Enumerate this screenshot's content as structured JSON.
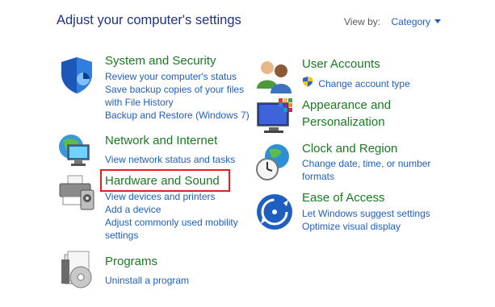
{
  "header": {
    "title": "Adjust your computer's settings",
    "view_by_label": "View by:",
    "view_by_value": "Category"
  },
  "categories": {
    "system_security": {
      "title": "System and Security",
      "links": [
        "Review your computer's status",
        "Save backup copies of your files",
        "with File History",
        "Backup and Restore (Windows 7)"
      ]
    },
    "network": {
      "title": "Network and Internet",
      "links": [
        "View network status and tasks"
      ]
    },
    "hardware": {
      "title": "Hardware and Sound",
      "links": [
        "View devices and printers",
        "Add a device",
        "Adjust commonly used mobility",
        "settings"
      ]
    },
    "programs": {
      "title": "Programs",
      "links": [
        "Uninstall a program"
      ]
    },
    "user_accounts": {
      "title": "User Accounts",
      "links": [
        "Change account type"
      ]
    },
    "appearance": {
      "title_line1": "Appearance and",
      "title_line2": "Personalization"
    },
    "clock": {
      "title": "Clock and Region",
      "links": [
        "Change date, time, or number",
        "formats"
      ]
    },
    "ease": {
      "title": "Ease of Access",
      "links": [
        "Let Windows suggest settings",
        "Optimize visual display"
      ]
    }
  },
  "colors": {
    "title_blue": "#1e3287",
    "category_green": "#1a7a23",
    "link_blue": "#1f5fbf",
    "highlight_red": "#e02020"
  },
  "icons": [
    "shield-icon",
    "network-icon",
    "printer-icon",
    "programs-icon",
    "users-icon",
    "appearance-icon",
    "clock-globe-icon",
    "ease-of-access-icon"
  ]
}
